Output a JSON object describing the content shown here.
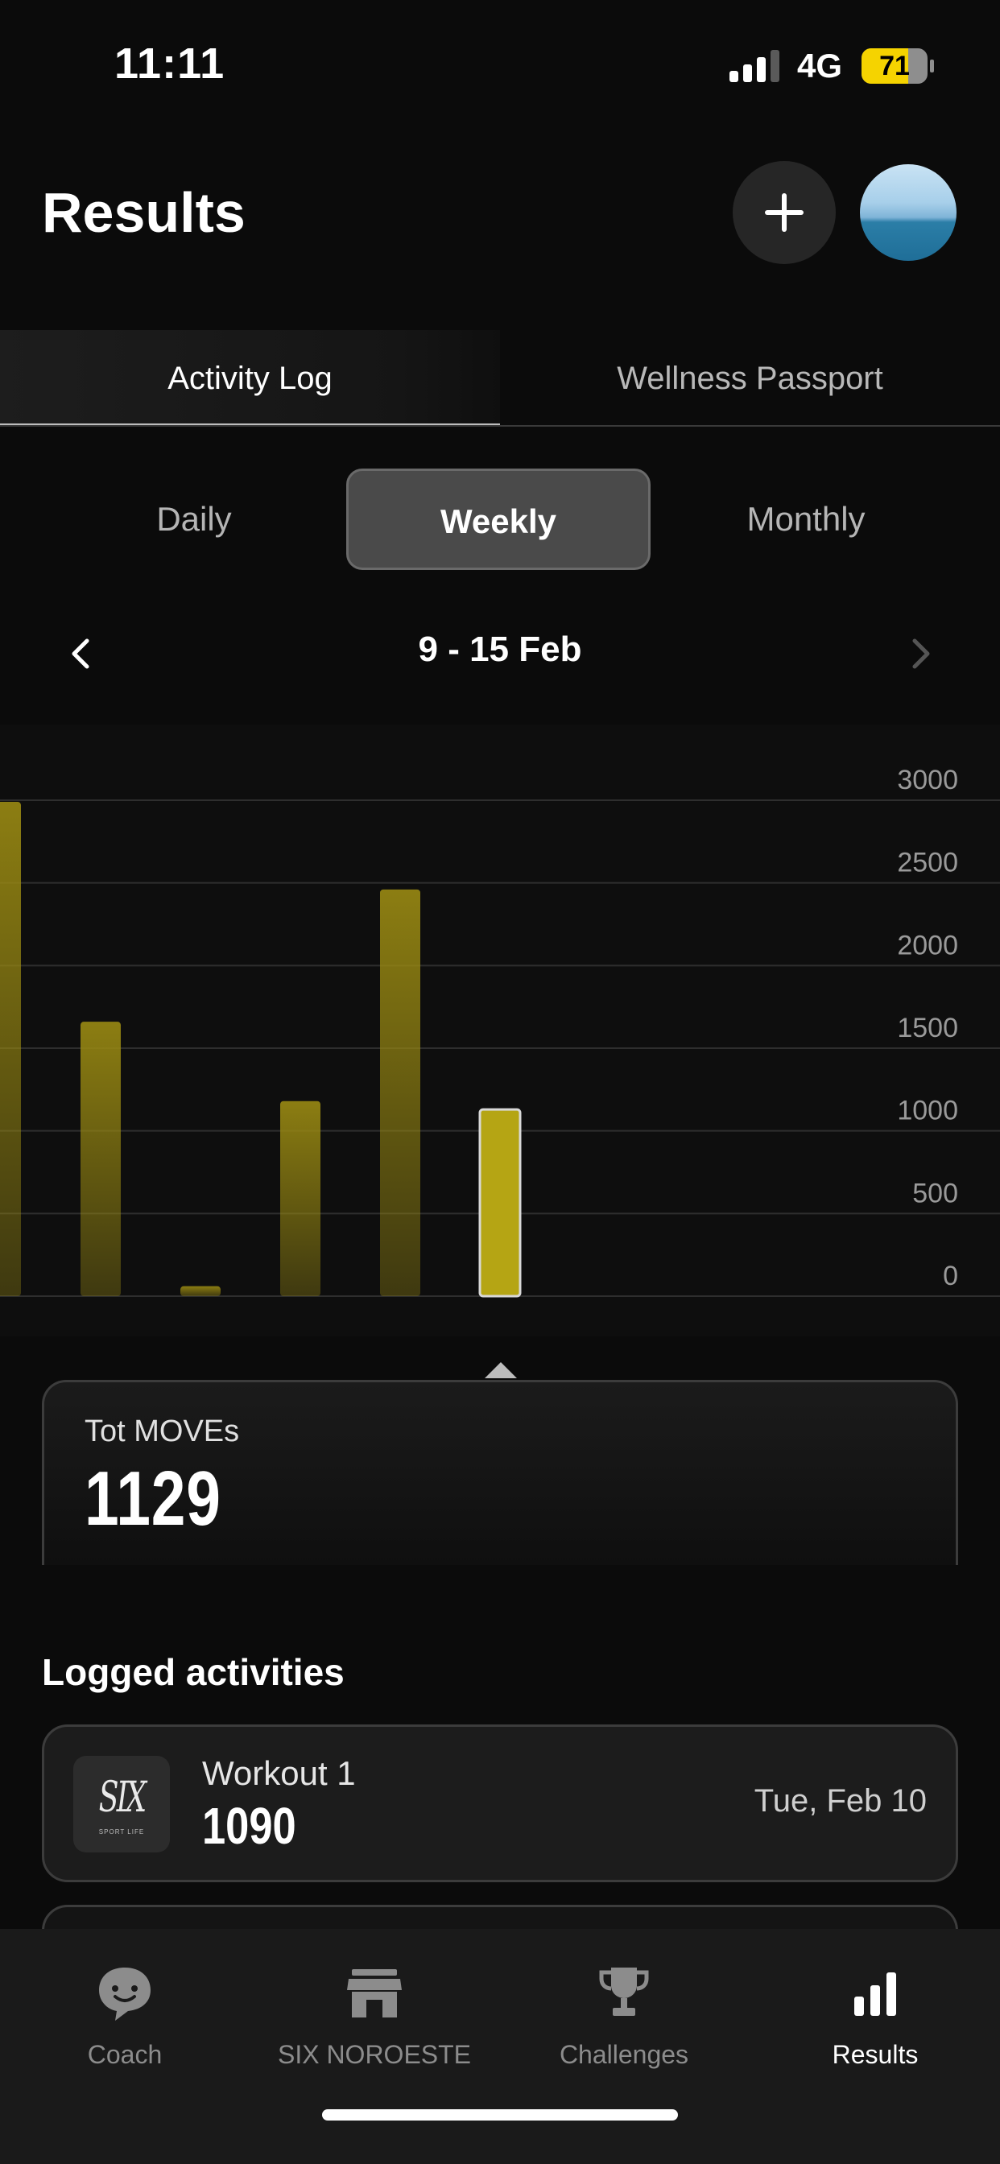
{
  "status_bar": {
    "time": "11:11",
    "network": "4G",
    "battery": "71",
    "battery_level": 0.71,
    "signal_bars_active": 3
  },
  "header": {
    "title": "Results",
    "add_icon": "plus-icon",
    "avatar_icon": "sea-photo-avatar"
  },
  "main_tabs": {
    "items": [
      "Activity Log",
      "Wellness Passport"
    ],
    "selected": "Activity Log"
  },
  "period": {
    "items": [
      "Daily",
      "Weekly",
      "Monthly"
    ],
    "selected": "Weekly"
  },
  "date_nav": {
    "range": "9 - 15 Feb",
    "prev_icon": "chevron-left-icon",
    "next_icon": "chevron-right-icon"
  },
  "chart_data": {
    "type": "bar",
    "categories": [
      "",
      "",
      "",
      "",
      "",
      ""
    ],
    "values": [
      2990,
      1660,
      60,
      1180,
      2460,
      1129
    ],
    "highlight_index": 5,
    "yticks": [
      3000,
      2500,
      2000,
      1500,
      1000,
      500,
      0
    ],
    "ylim": [
      0,
      3000
    ],
    "grid": true,
    "bar_color": "#9a8a12",
    "highlight_color": "#b5a514",
    "title": "",
    "xlabel": "",
    "ylabel": ""
  },
  "total": {
    "label": "Tot MOVEs",
    "value": "1129"
  },
  "logged": {
    "heading": "Logged activities",
    "items": [
      {
        "logo_text": "SIX",
        "logo_sub": "SPORT LIFE",
        "name": "Workout 1",
        "moves": "1090",
        "date": "Tue, Feb 10"
      }
    ]
  },
  "bottom_nav": {
    "items": [
      {
        "label": "Coach",
        "icon": "coach-chat-icon"
      },
      {
        "label": "SIX NOROESTE",
        "icon": "store-icon"
      },
      {
        "label": "Challenges",
        "icon": "trophy-icon"
      },
      {
        "label": "Results",
        "icon": "bar-chart-icon"
      }
    ],
    "selected": "Results"
  },
  "colors": {
    "background": "#0b0b0b",
    "accent": "#f5d300",
    "bar": "#9a8a12"
  }
}
